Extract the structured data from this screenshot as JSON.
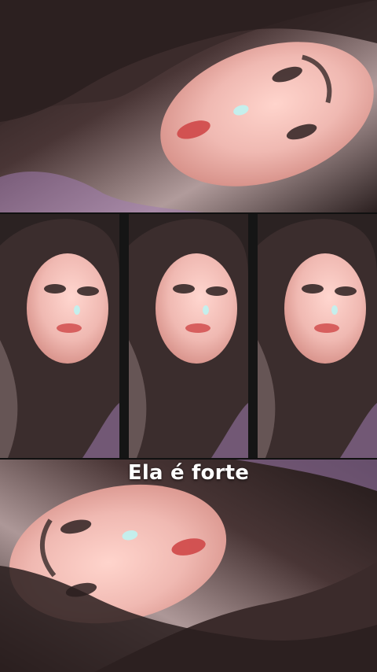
{
  "caption": {
    "text": "Ela é forte"
  },
  "palette": {
    "skin": "#f0b9b2",
    "skin_shadow": "#d58e86",
    "hair_dark": "#2a1f1f",
    "hair_mid": "#5b4444",
    "hair_light": "#b7a1a1",
    "lips": "#d14d4d",
    "background_lavender": "#a17bb0",
    "divider": "#111111",
    "caption_color": "#ffffff"
  }
}
